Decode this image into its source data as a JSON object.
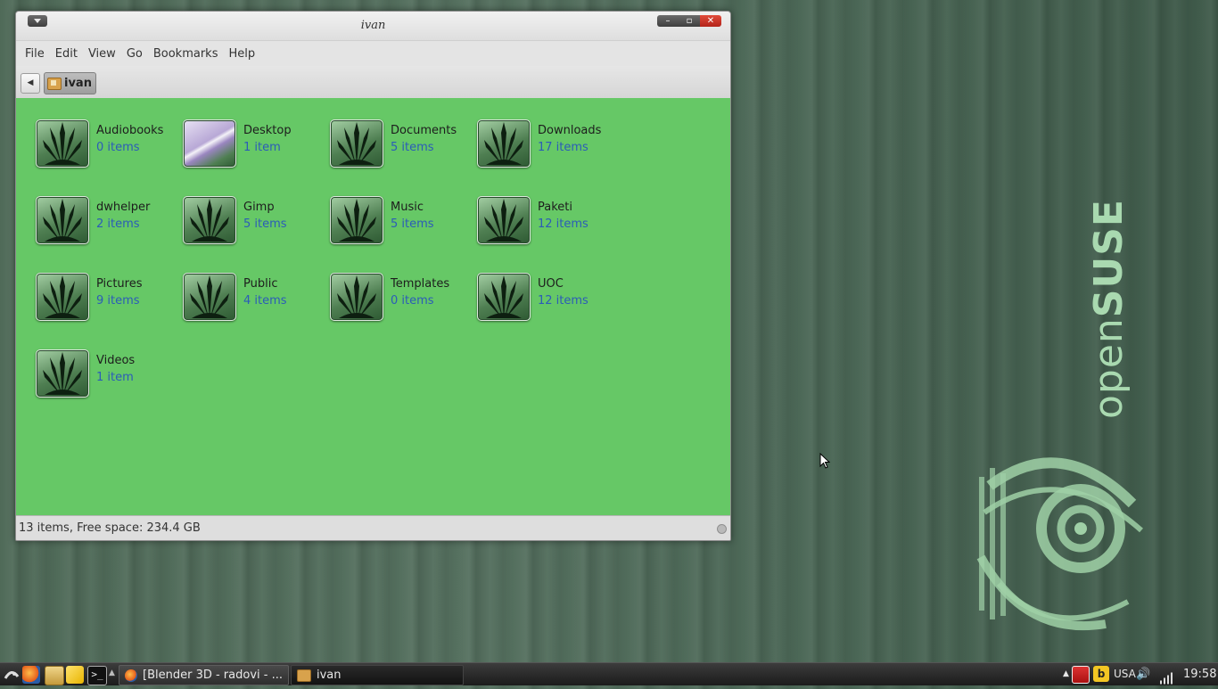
{
  "window": {
    "title": "ivan",
    "menu": [
      "File",
      "Edit",
      "View",
      "Go",
      "Bookmarks",
      "Help"
    ],
    "location": "ivan",
    "status": "13 items, Free space: 234.4 GB"
  },
  "folders": [
    {
      "name": "Audiobooks",
      "count": "0 items",
      "icon": "folder-icon"
    },
    {
      "name": "Desktop",
      "count": "1 item",
      "icon": "desktop-folder-icon"
    },
    {
      "name": "Documents",
      "count": "5 items",
      "icon": "folder-icon"
    },
    {
      "name": "Downloads",
      "count": "17 items",
      "icon": "folder-icon"
    },
    {
      "name": "dwhelper",
      "count": "2 items",
      "icon": "folder-icon"
    },
    {
      "name": "Gimp",
      "count": "5 items",
      "icon": "folder-icon"
    },
    {
      "name": "Music",
      "count": "5 items",
      "icon": "folder-icon"
    },
    {
      "name": "Paketi",
      "count": "12 items",
      "icon": "folder-icon"
    },
    {
      "name": "Pictures",
      "count": "9 items",
      "icon": "folder-icon"
    },
    {
      "name": "Public",
      "count": "4 items",
      "icon": "folder-icon"
    },
    {
      "name": "Templates",
      "count": "0 items",
      "icon": "folder-icon"
    },
    {
      "name": "UOC",
      "count": "12 items",
      "icon": "folder-icon"
    },
    {
      "name": "Videos",
      "count": "1 item",
      "icon": "folder-icon"
    }
  ],
  "desktop": {
    "brand_light": "open",
    "brand_bold": "SUSE"
  },
  "taskbar": {
    "tasks": [
      {
        "label": "[Blender 3D - radovi - ...",
        "icon": "firefox-icon",
        "active": false
      },
      {
        "label": "ivan",
        "icon": "folder-icon",
        "active": true
      }
    ],
    "keyboard_layout": "USA",
    "clock": "19:58"
  },
  "colors": {
    "content_bg": "#66c866",
    "count_text": "#2b5cb8",
    "brand_green": "#a9d9b0"
  }
}
